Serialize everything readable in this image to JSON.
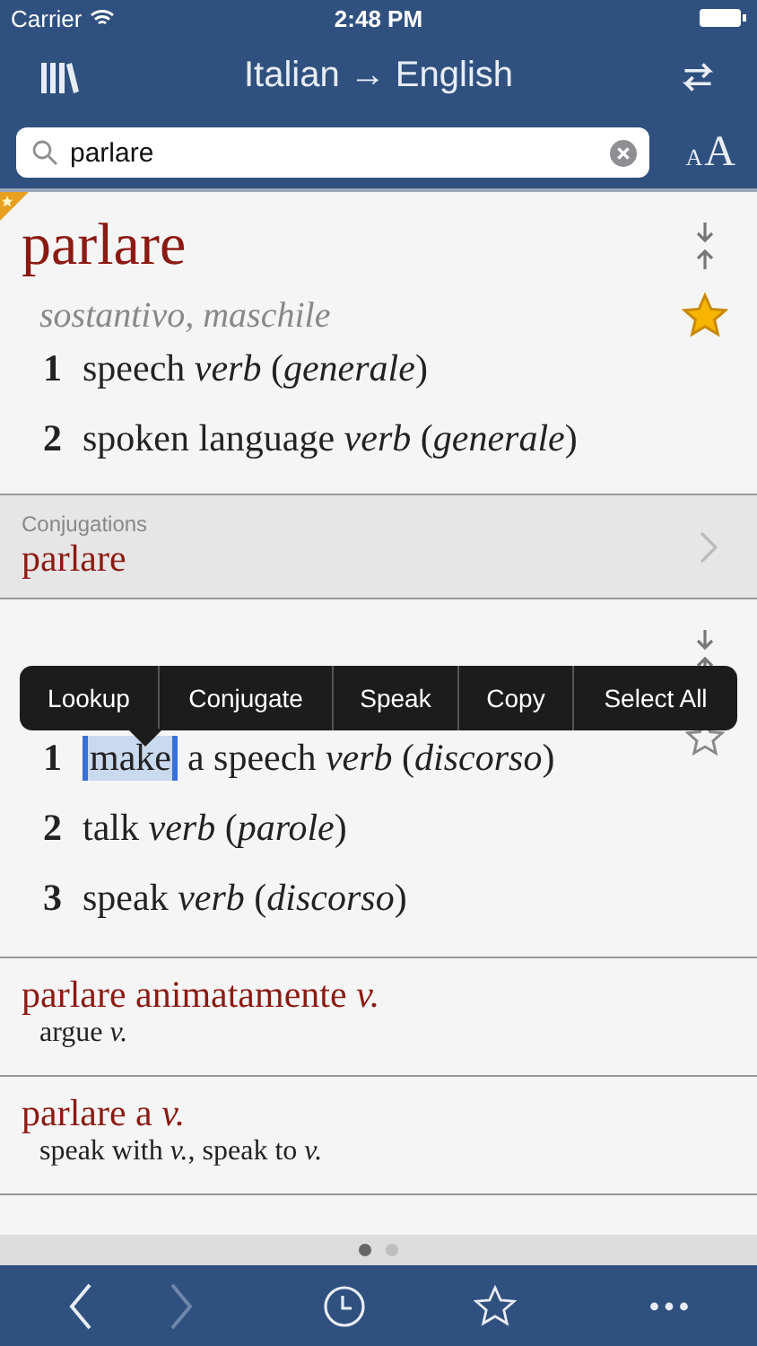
{
  "status_bar": {
    "carrier": "Carrier",
    "time": "2:48 PM"
  },
  "nav": {
    "title": "Italian → English"
  },
  "search": {
    "value": "parlare"
  },
  "font_button": {
    "small": "A",
    "large": "A"
  },
  "entry": {
    "headword": "parlare",
    "pos": "sostantivo, maschile",
    "favorite": true,
    "marked": true,
    "senses": [
      {
        "num": "1",
        "text": "speech *verb* (*generale*)"
      },
      {
        "num": "2",
        "text": "spoken language *verb* (*generale*)"
      }
    ]
  },
  "conjugations": {
    "label": "Conjugations",
    "word": "parlare"
  },
  "entry2": {
    "favorite": false,
    "senses": [
      {
        "num": "1",
        "selection": "make",
        "text": "a speech *verb* (*discorso*)"
      },
      {
        "num": "2",
        "text": "talk *verb* (*parole*)"
      },
      {
        "num": "3",
        "text": "speak *verb* (*discorso*)"
      }
    ]
  },
  "context_menu": {
    "items": [
      "Lookup",
      "Conjugate",
      "Speak",
      "Copy",
      "Select All"
    ]
  },
  "phrases": [
    {
      "headword": "parlare animatamente *v.*",
      "translation": "argue *v.*"
    },
    {
      "headword": "parlare a *v.*",
      "translation": "speak with *v.*, speak to *v.*"
    }
  ],
  "pages": [
    {
      "selected": true
    },
    {
      "selected": false
    }
  ],
  "toolbar": {
    "back": {
      "disabled": false
    },
    "forward": {
      "disabled": true
    }
  }
}
